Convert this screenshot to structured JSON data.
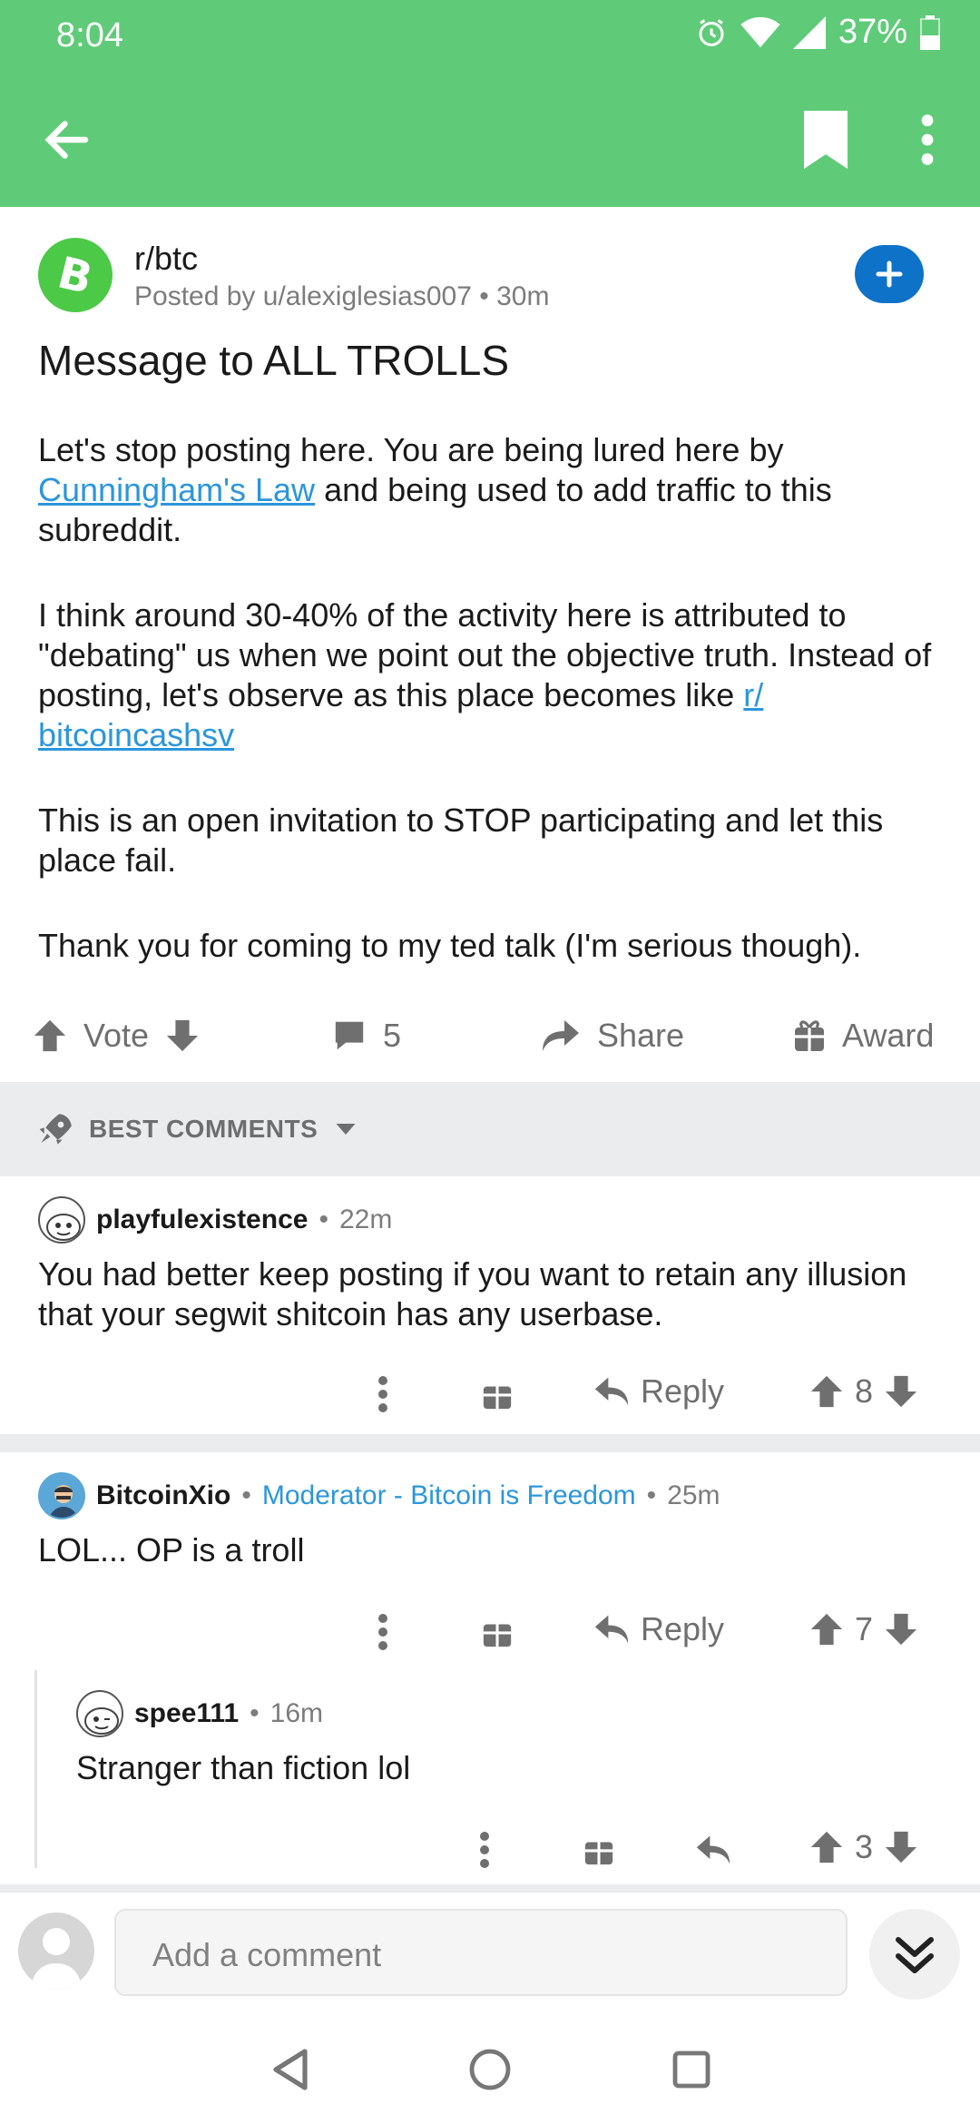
{
  "status_bar": {
    "time": "8:04",
    "battery": "37%"
  },
  "post": {
    "subreddit": "r/btc",
    "posted_by": "Posted by u/alexiglesias007",
    "age": "30m",
    "title": "Message to ALL TROLLS",
    "p1_a": "Let's stop posting here. You are being lured here by ",
    "p1_link": "Cunningham's Law",
    "p1_b": " and being used to add traffic to this subreddit.",
    "p2_a": "I think around 30-40% of the activity here is attributed to \"debating\" us when we point out the objective truth. Instead of posting, let's observe as this place becomes like ",
    "p2_link": "r/ bitcoincashsv",
    "p3": "This is an open invitation to STOP participating and let this place fail.",
    "p4": "Thank you for coming to my ted talk (I'm serious though).",
    "vote_label": "Vote",
    "comment_count": "5",
    "share_label": "Share",
    "award_label": "Award"
  },
  "sort": {
    "label": "BEST COMMENTS"
  },
  "comments": [
    {
      "author": "playfulexistence",
      "age": "22m",
      "body": "You had better keep posting if you want to retain any illusion that your segwit shitcoin has any userbase.",
      "reply_label": "Reply",
      "score": "8"
    },
    {
      "author": "BitcoinXio",
      "flair": "Moderator - Bitcoin is Freedom",
      "age": "25m",
      "body": "LOL... OP is a troll",
      "reply_label": "Reply",
      "score": "7"
    },
    {
      "author": "spee111",
      "age": "16m",
      "body": "Stranger than fiction lol",
      "score": "3"
    }
  ],
  "composer": {
    "placeholder": "Add a comment"
  },
  "icons": {
    "back": "arrow-left-icon",
    "bookmark": "bookmark-icon",
    "more": "more-vertical-icon",
    "sub": "bitcoin-icon",
    "join": "plus-icon",
    "upvote": "arrow-up-icon",
    "downvote": "arrow-down-icon",
    "comments": "comment-icon",
    "share": "share-icon",
    "award": "gift-icon",
    "sort": "rocket-icon",
    "reply": "reply-icon",
    "jump": "double-chevron-down-icon"
  },
  "colors": {
    "header": "#5fcb78",
    "link": "#2b96dc",
    "join": "#0f72c9",
    "sub_avatar": "#4cc947"
  }
}
